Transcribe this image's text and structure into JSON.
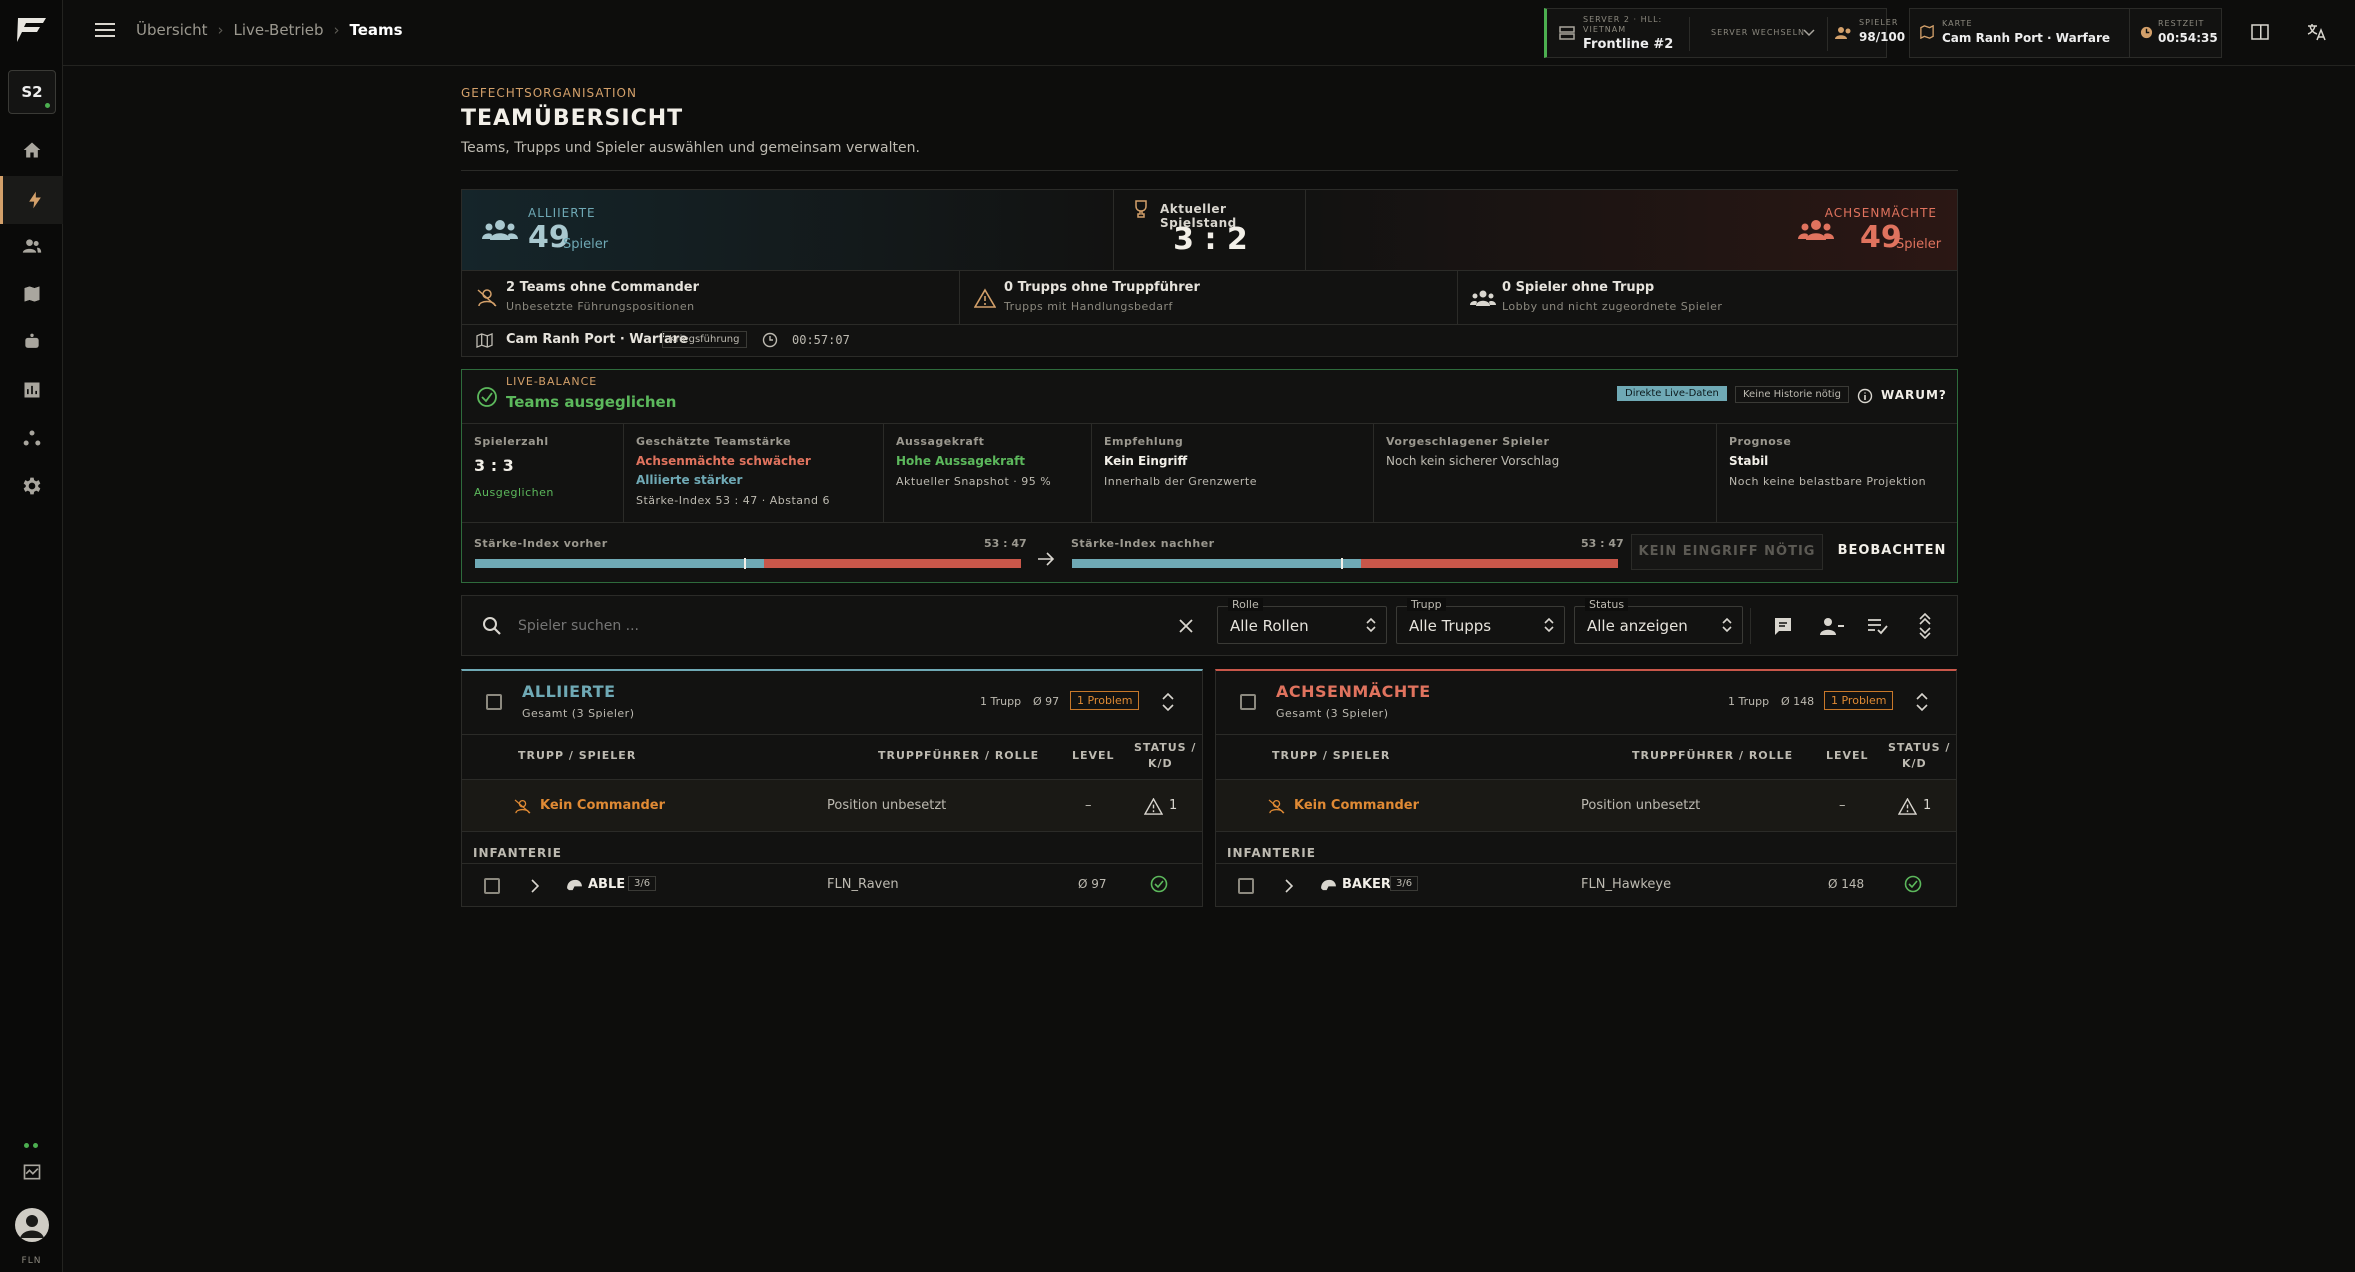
{
  "sidebar": {
    "badge": "S2",
    "footer": "FLN"
  },
  "topbar": {
    "breadcrumb": [
      "Übersicht",
      "Live-Betrieb",
      "Teams"
    ],
    "server": {
      "line1": "SERVER 2 · HLL:",
      "line2": "VIETNAM",
      "name": "Frontline #2",
      "switch": "SERVER WECHSELN"
    },
    "players": {
      "label": "SPIELER",
      "value": "98/100"
    },
    "map": {
      "label": "KARTE",
      "value": "Cam Ranh Port · Warfare"
    },
    "remaining": {
      "label": "RESTZEIT",
      "value": "00:54:35"
    }
  },
  "header": {
    "eyebrow": "GEFECHTSORGANISATION",
    "title": "TEAMÜBERSICHT",
    "subtitle": "Teams, Trupps und Spieler auswählen und gemeinsam verwalten."
  },
  "score": {
    "allies_label": "ALLIIERTE",
    "allies_count": "49",
    "allies_unit": "Spieler",
    "score_label": "Aktueller Spielstand",
    "score_value": "3 : 2",
    "axis_label": "ACHSENMÄCHTE",
    "axis_count": "49",
    "axis_unit": "Spieler",
    "issues": [
      {
        "title": "2 Teams ohne Commander",
        "sub": "Unbesetzte Führungspositionen"
      },
      {
        "title": "0 Trupps ohne Truppführer",
        "sub": "Trupps mit Handlungsbedarf"
      },
      {
        "title": "0 Spieler ohne Trupp",
        "sub": "Lobby und nicht zugeordnete Spieler"
      }
    ],
    "map": "Cam Ranh Port · Warfare",
    "mode": "Kriegsführung",
    "elapsed": "00:57:07"
  },
  "balance": {
    "eyebrow": "LIVE-BALANCE",
    "title": "Teams ausgeglichen",
    "tag_live": "Direkte Live-Daten",
    "tag_history": "Keine Historie nötig",
    "why": "WARUM?",
    "cols": [
      {
        "label": "Spielerzahl",
        "value": "3 : 3",
        "note": "Ausgeglichen"
      },
      {
        "label": "Geschätzte Teamstärke",
        "value": "Achsenmächte schwächer",
        "value2": "Alliierte stärker",
        "note": "Stärke-Index 53 : 47 · Abstand 6"
      },
      {
        "label": "Aussagekraft",
        "value": "Hohe Aussagekraft",
        "note": "Aktueller Snapshot · 95 %"
      },
      {
        "label": "Empfehlung",
        "value": "Kein Eingriff",
        "note": "Innerhalb der Grenzwerte"
      },
      {
        "label": "Vorgeschlagener Spieler",
        "value": "Noch kein sicherer Vorschlag"
      },
      {
        "label": "Prognose",
        "value": "Stabil",
        "note": "Noch keine belastbare Projektion"
      }
    ],
    "before_label": "Stärke-Index vorher",
    "before_value": "53 : 47",
    "before_share": 0.53,
    "after_label": "Stärke-Index nachher",
    "after_value": "53 : 47",
    "after_share": 0.53,
    "btn_disabled": "KEIN EINGRIFF NÖTIG",
    "btn_observe": "BEOBACHTEN"
  },
  "filters": {
    "search_placeholder": "Spieler suchen ...",
    "role_label": "Rolle",
    "role_value": "Alle Rollen",
    "squad_label": "Trupp",
    "squad_value": "Alle Trupps",
    "status_label": "Status",
    "status_value": "Alle anzeigen"
  },
  "teams": [
    {
      "name": "ALLIIERTE",
      "total": "Gesamt (3 Spieler)",
      "squads": "1 Trupp",
      "avg": "Ø 97",
      "problem": "1 Problem",
      "color": "#6fa9b5",
      "cols": [
        "TRUPP / SPIELER",
        "TRUPPFÜHRER / ROLLE",
        "LEVEL",
        "STATUS /",
        "K/D"
      ],
      "commander": "Kein Commander",
      "commander_pos": "Position unbesetzt",
      "commander_level": "–",
      "commander_status": "1",
      "section": "INFANTERIE",
      "squad_name": "ABLE",
      "squad_size": "3/6",
      "squad_lead": "FLN_Raven",
      "squad_level": "Ø 97"
    },
    {
      "name": "ACHSENMÄCHTE",
      "total": "Gesamt (3 Spieler)",
      "squads": "1 Trupp",
      "avg": "Ø 148",
      "problem": "1 Problem",
      "color": "#e0735e",
      "cols": [
        "TRUPP / SPIELER",
        "TRUPPFÜHRER / ROLLE",
        "LEVEL",
        "STATUS /",
        "K/D"
      ],
      "commander": "Kein Commander",
      "commander_pos": "Position unbesetzt",
      "commander_level": "–",
      "commander_status": "1",
      "section": "INFANTERIE",
      "squad_name": "BAKER",
      "squad_size": "3/6",
      "squad_lead": "FLN_Hawkeye",
      "squad_level": "Ø 148"
    }
  ],
  "colors": {
    "accent": "#d3a06a",
    "allies": "#6fa9b5",
    "axis": "#e0735e",
    "good": "#5cb85c",
    "warn": "#e08a34"
  }
}
